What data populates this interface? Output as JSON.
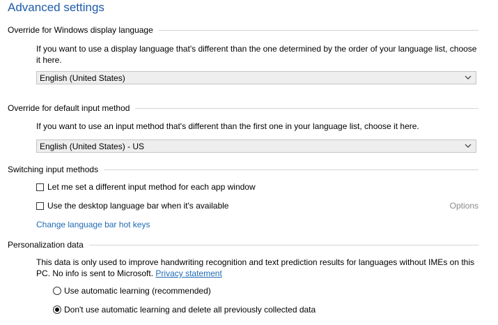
{
  "page": {
    "title": "Advanced settings"
  },
  "display_language": {
    "heading": "Override for Windows display language",
    "description": "If you want to use a display language that's different than the one determined by the order of your language list, choose it here.",
    "selected": "English (United States)"
  },
  "input_method": {
    "heading": "Override for default input method",
    "description": "If you want to use an input method that's different than the first one in your language list, choose it here.",
    "selected": "English (United States) - US"
  },
  "switching": {
    "heading": "Switching input methods",
    "per_app_label": "Let me set a different input method for each app window",
    "per_app_checked": false,
    "language_bar_label": "Use the desktop language bar when it's available",
    "language_bar_checked": false,
    "options_label": "Options",
    "hotkeys_link": "Change language bar hot keys"
  },
  "personalization": {
    "heading": "Personalization data",
    "description": "This data is only used to improve handwriting recognition and text prediction results for languages without IMEs on this PC. No info is sent to Microsoft.",
    "privacy_link": "Privacy statement",
    "option_auto": "Use automatic learning (recommended)",
    "option_no_auto": "Don't use automatic learning and delete all previously collected data",
    "selected_option": "option_no_auto"
  },
  "colors": {
    "title": "#1e5aa8",
    "link": "#1e6ab4",
    "disabled_text": "#8a8a8a",
    "dropdown_bg": "#eeeeee"
  },
  "icons": {
    "dropdown": "chevron-down-icon"
  }
}
